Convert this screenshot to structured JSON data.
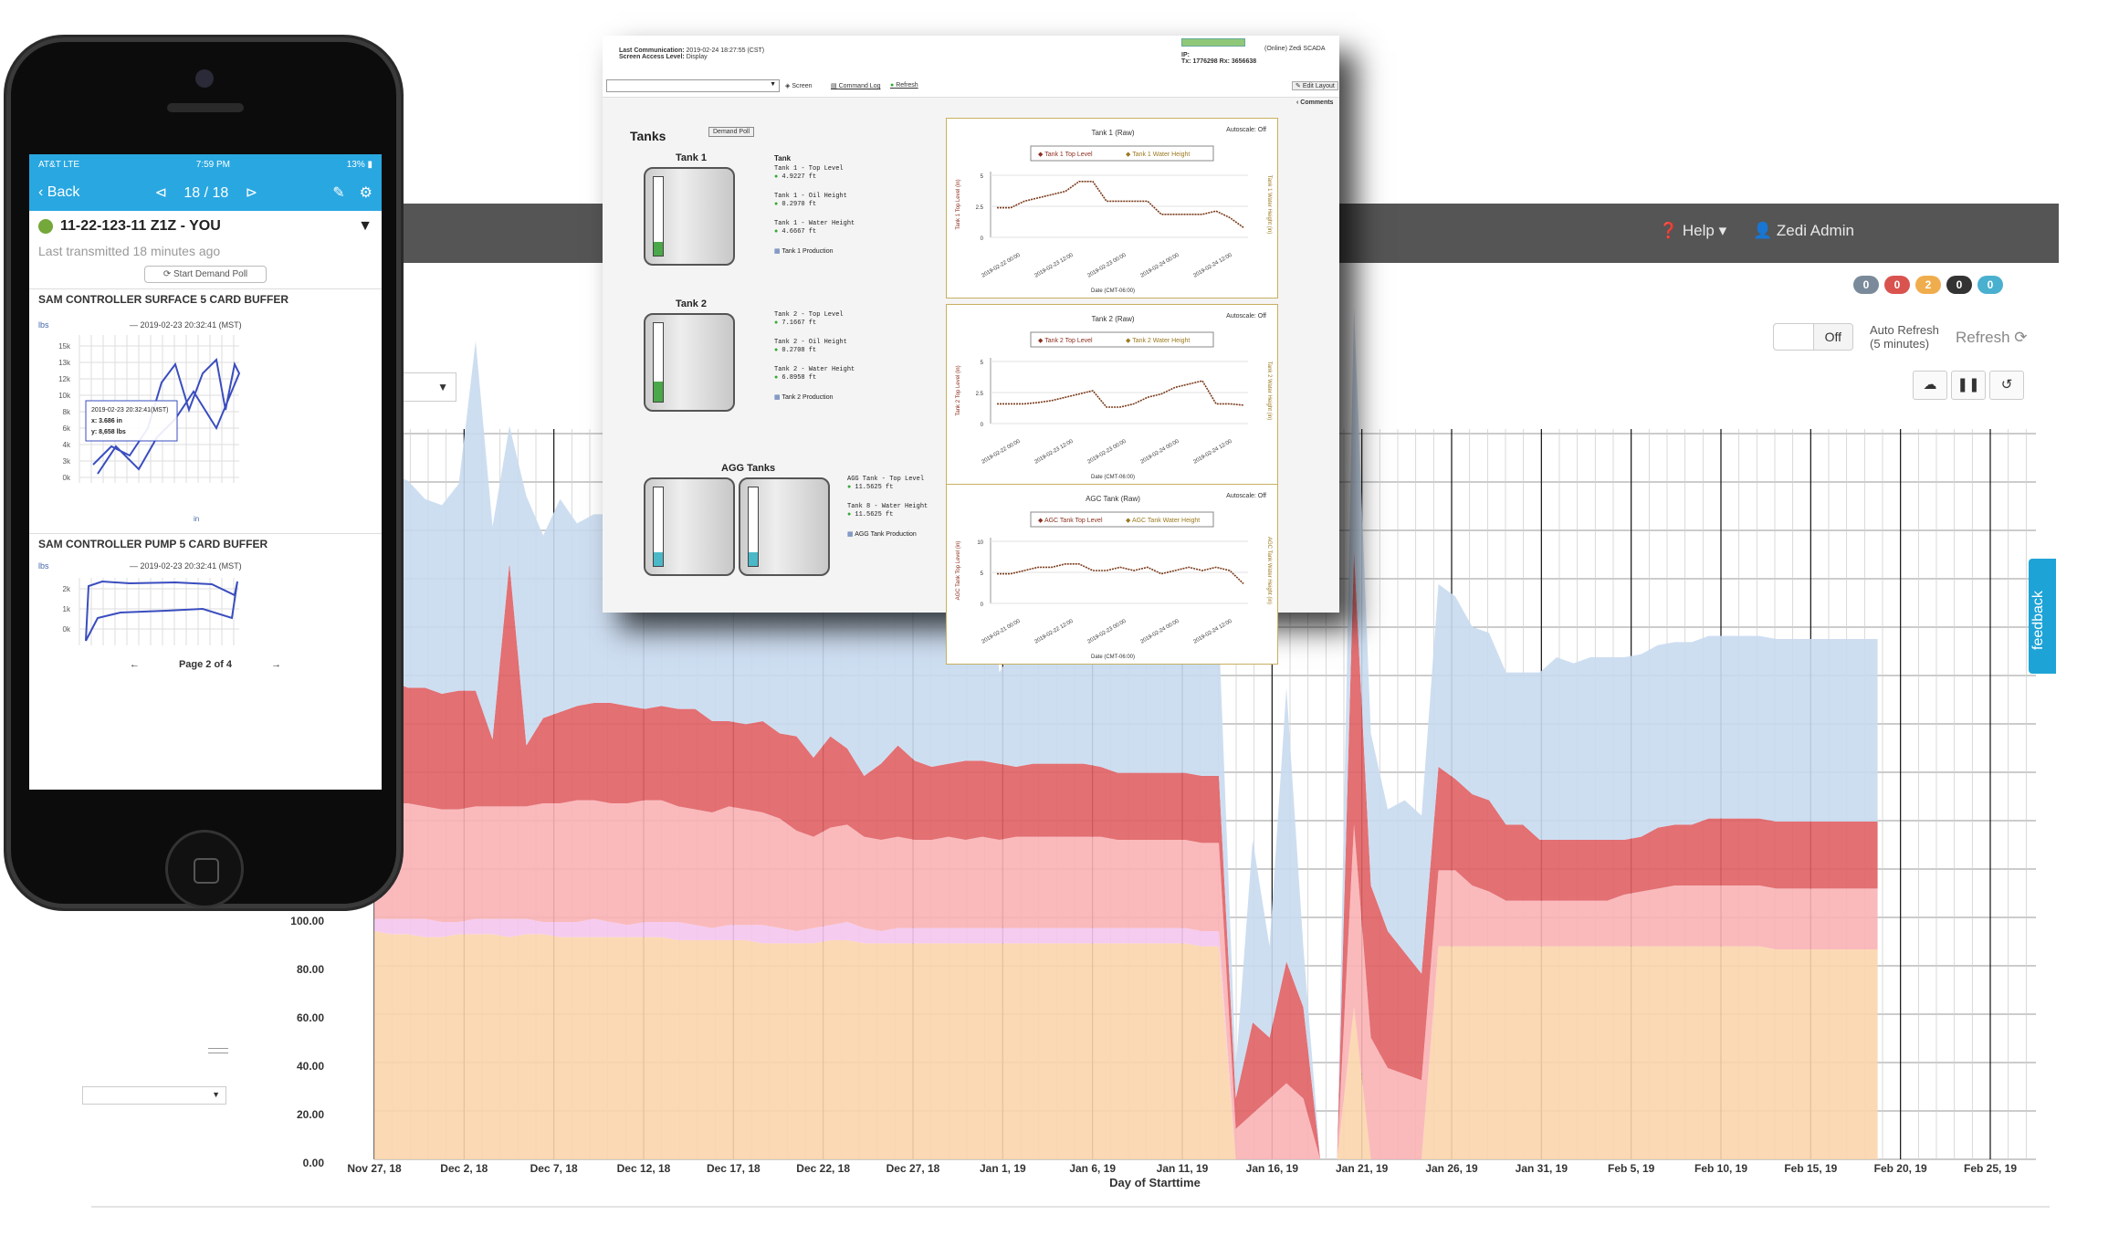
{
  "dashboard": {
    "menu_help": "Help",
    "menu_user": "Zedi Admin",
    "badges": [
      {
        "value": "0",
        "color": "#7a8a9a"
      },
      {
        "value": "0",
        "color": "#d9534f"
      },
      {
        "value": "2",
        "color": "#f0ad4e"
      },
      {
        "value": "0",
        "color": "#333333"
      },
      {
        "value": "0",
        "color": "#4ab0d0"
      }
    ],
    "toggle_state": "Off",
    "auto_refresh_label": "Auto Refresh",
    "auto_refresh_interval": "(5 minutes)",
    "refresh_label": "Refresh",
    "feedback_label": "feedback"
  },
  "chart_data": {
    "type": "area",
    "xlabel": "Day of Starttime",
    "ylabel": "",
    "x_ticks": [
      "Nov 27, 18",
      "Dec 2, 18",
      "Dec 7, 18",
      "Dec 12, 18",
      "Dec 17, 18",
      "Dec 22, 18",
      "Dec 27, 18",
      "Jan 1, 19",
      "Jan 6, 19",
      "Jan 11, 19",
      "Jan 16, 19",
      "Jan 21, 19",
      "Jan 26, 19",
      "Jan 31, 19",
      "Feb 5, 19",
      "Feb 10, 19",
      "Feb 15, 19",
      "Feb 20, 19",
      "Feb 25, 19"
    ],
    "y_ticks": [
      "100.00",
      "80.00",
      "60.00",
      "40.00",
      "20.00",
      "0.00"
    ],
    "ylim": [
      0,
      300
    ],
    "stacked": true,
    "series": [
      {
        "color": "#fbd5ac",
        "values": [
          75,
          74,
          74,
          73,
          73,
          74,
          74,
          74,
          73,
          74,
          74,
          73,
          73,
          73,
          73,
          73,
          73,
          73,
          72,
          72,
          72,
          72,
          72,
          71,
          71,
          71,
          71,
          72,
          72,
          71,
          71,
          71,
          71,
          71,
          71,
          71,
          71,
          71,
          71,
          71,
          71,
          71,
          71,
          71,
          71,
          71,
          71,
          71,
          71,
          70,
          70,
          0,
          0,
          0,
          0,
          0,
          0,
          0,
          50,
          0,
          0,
          0,
          0,
          70,
          70,
          70,
          70,
          70,
          70,
          70,
          70,
          70,
          70,
          70,
          70,
          70,
          70,
          70,
          70,
          70,
          70,
          70,
          70,
          69,
          69,
          69,
          69,
          69,
          69,
          69
        ]
      },
      {
        "color": "#f4c7ee",
        "values": [
          4,
          5,
          5,
          6,
          5,
          4,
          5,
          5,
          6,
          5,
          4,
          5,
          5,
          6,
          5,
          4,
          5,
          5,
          6,
          5,
          4,
          5,
          5,
          6,
          5,
          4,
          5,
          5,
          6,
          5,
          4,
          5,
          5,
          5,
          5,
          5,
          5,
          5,
          5,
          5,
          5,
          5,
          5,
          5,
          5,
          5,
          5,
          5,
          5,
          5,
          5,
          0,
          0,
          0,
          0,
          0,
          0,
          0,
          0,
          0,
          0,
          0,
          0,
          0,
          0,
          0,
          0,
          0,
          0,
          0,
          0,
          0,
          0,
          0,
          0,
          0,
          0,
          0,
          0,
          0,
          0,
          0,
          0,
          0,
          0,
          0,
          0,
          0,
          0,
          0
        ]
      },
      {
        "color": "#f9b3b5",
        "values": [
          36,
          38,
          38,
          37,
          37,
          37,
          37,
          37,
          37,
          37,
          39,
          39,
          40,
          39,
          39,
          40,
          40,
          40,
          38,
          38,
          38,
          39,
          38,
          37,
          36,
          33,
          30,
          32,
          32,
          30,
          30,
          30,
          29,
          29,
          30,
          29,
          30,
          29,
          30,
          30,
          30,
          30,
          30,
          30,
          29,
          29,
          29,
          29,
          29,
          29,
          29,
          10,
          15,
          20,
          25,
          20,
          0,
          0,
          60,
          40,
          30,
          28,
          26,
          25,
          25,
          20,
          18,
          15,
          15,
          15,
          15,
          15,
          15,
          15,
          17,
          18,
          19,
          20,
          20,
          20,
          20,
          20,
          20,
          20,
          20,
          20,
          20,
          20,
          20,
          20
        ]
      },
      {
        "color": "#e06064",
        "values": [
          38,
          40,
          38,
          39,
          38,
          39,
          38,
          22,
          80,
          20,
          28,
          30,
          31,
          32,
          33,
          32,
          30,
          31,
          32,
          33,
          30,
          28,
          28,
          30,
          28,
          31,
          26,
          30,
          25,
          20,
          25,
          30,
          26,
          24,
          24,
          26,
          25,
          25,
          23,
          24,
          24,
          24,
          24,
          23,
          22,
          22,
          22,
          22,
          22,
          22,
          22,
          10,
          30,
          20,
          40,
          30,
          0,
          0,
          90,
          50,
          45,
          40,
          35,
          34,
          30,
          30,
          30,
          25,
          25,
          20,
          20,
          20,
          20,
          20,
          18,
          18,
          20,
          20,
          20,
          22,
          22,
          22,
          22,
          22,
          22,
          22,
          22,
          22,
          22,
          22
        ]
      },
      {
        "color": "#c9daf0",
        "values": [
          70,
          68,
          68,
          62,
          62,
          68,
          115,
          70,
          45,
          82,
          60,
          70,
          60,
          62,
          62,
          58,
          60,
          55,
          58,
          55,
          56,
          58,
          55,
          58,
          50,
          54,
          58,
          60,
          53,
          60,
          58,
          53,
          60,
          52,
          52,
          55,
          100,
          30,
          40,
          50,
          50,
          48,
          40,
          44,
          42,
          40,
          50,
          50,
          50,
          50,
          48,
          10,
          60,
          30,
          90,
          20,
          0,
          0,
          80,
          50,
          40,
          50,
          52,
          60,
          60,
          55,
          55,
          50,
          50,
          55,
          60,
          58,
          60,
          60,
          60,
          60,
          60,
          60,
          60,
          60,
          60,
          60,
          60,
          60,
          60,
          60,
          60,
          60,
          60,
          60
        ]
      }
    ]
  },
  "phone": {
    "status_left": "AT&T  LTE",
    "status_time": "7:59 PM",
    "status_right": "13% ▮",
    "back_label": "Back",
    "pager": "18 / 18",
    "well_name": "11-22-123-11 Z1Z - YOU",
    "last_transmitted": "Last transmitted 18 minutes ago",
    "demand_poll": "Start Demand Poll",
    "section1": "SAM CONTROLLER SURFACE 5 CARD BUFFER",
    "chart1_title": "2019-02-23 20:32:41 (MST)",
    "chart1_yunit": "lbs",
    "chart1_yticks": [
      "15k",
      "13k",
      "12k",
      "10k",
      "8k",
      "6k",
      "4k",
      "3k",
      "0k"
    ],
    "chart1_tooltip": [
      "2019-02-23 20:32:41(MST)",
      "x: 3.686 in",
      "y: 8,658 lbs"
    ],
    "chart1_xunit": "in",
    "section2": "SAM CONTROLLER PUMP 5 CARD BUFFER",
    "chart2_title": "2019-02-23 20:32:41 (MST)",
    "chart2_yunit": "lbs",
    "chart2_yticks": [
      "2k",
      "1k",
      "0k"
    ],
    "page_label": "Page 2 of 4"
  },
  "scada": {
    "last_comm_label": "Last Communication:",
    "last_comm_value": "2019-02-24 18:27:55 (CST)",
    "access_label": "Screen Access Level:",
    "access_value": "Display",
    "status": "(Online) Zedi SCADA",
    "ip": "IP:",
    "txrx": "Tx: 1776298  Rx: 3656638",
    "screen_label": "Screen",
    "command_log": "Command Log",
    "refresh": "Refresh",
    "edit_layout": "Edit Layout",
    "comments": "Comments",
    "tanks_title": "Tanks",
    "demand_poll": "Demand Poll",
    "tanks": [
      {
        "name": "Tank 1",
        "group": "Tank",
        "fill": 0.18,
        "fill_color": "#4aa84a",
        "readings": [
          {
            "label": "Tank 1 - Top Level",
            "value": "4.9227 ft"
          },
          {
            "label": "Tank 1 - Oil Height",
            "value": "0.2970 ft"
          },
          {
            "label": "Tank 1 - Water Height",
            "value": "4.6667 ft"
          }
        ],
        "production": "Tank 1 Production"
      },
      {
        "name": "Tank 2",
        "group": "",
        "fill": 0.26,
        "fill_color": "#4aa84a",
        "readings": [
          {
            "label": "Tank 2 - Top Level",
            "value": "7.1667 ft"
          },
          {
            "label": "Tank 2 - Oil Height",
            "value": "0.2708 ft"
          },
          {
            "label": "Tank 2 - Water Height",
            "value": "6.8958 ft"
          }
        ],
        "production": "Tank 2 Production"
      },
      {
        "name": "AGG Tanks",
        "group": "",
        "fill": 0.18,
        "fill_color": "#4bb8c8",
        "readings": [
          {
            "label": "AGG Tank - Top Level",
            "value": "11.5625 ft"
          },
          {
            "label": "Tank 8 - Water Height",
            "value": "11.5625 ft"
          }
        ],
        "production": "AGG Tank Production"
      }
    ],
    "charts": [
      {
        "title": "Tank 1 (Raw)",
        "autoscale": "Autoscale: Off",
        "legend": [
          "Tank 1 Top Level",
          "Tank 1 Water Height"
        ],
        "ylabel_left": "Tank 1 Top Level (in)",
        "ylabel_right": "Tank 1 Water Height (in)",
        "xlabel": "Date (CMT-06:00)",
        "xticks": [
          "2019-02-22 00:00",
          "2019-02-23 12:00",
          "2019-02-23 00:00",
          "2019-02-24 00:00",
          "2019-02-24 12:00"
        ],
        "yticks": [
          "5",
          "2.5",
          "0"
        ]
      },
      {
        "title": "Tank 2 (Raw)",
        "autoscale": "Autoscale: Off",
        "legend": [
          "Tank 2 Top Level",
          "Tank 2 Water Height"
        ],
        "ylabel_left": "Tank 2 Top Level (in)",
        "ylabel_right": "Tank 2 Water Height (in)",
        "xlabel": "Date (CMT-06:00)",
        "xticks": [
          "2019-02-22 00:00",
          "2019-02-23 12:00",
          "2019-02-23 00:00",
          "2019-02-24 00:00",
          "2019-02-24 12:00"
        ],
        "yticks": [
          "5",
          "2.5",
          "0"
        ]
      },
      {
        "title": "AGC Tank (Raw)",
        "autoscale": "Autoscale: Off",
        "legend": [
          "AGC Tank Top Level",
          "AGC Tank Water Height"
        ],
        "ylabel_left": "AGC Tank Top Level (in)",
        "ylabel_right": "AGC Tank Water Height (in)",
        "xlabel": "Date (CMT-06:00)",
        "xticks": [
          "2019-02-21 00:00",
          "2019-02-22 12:00",
          "2019-02-23 00:00",
          "2019-02-24 00:00",
          "2019-02-24 12:00"
        ],
        "yticks": [
          "10",
          "5",
          "0"
        ]
      }
    ]
  }
}
